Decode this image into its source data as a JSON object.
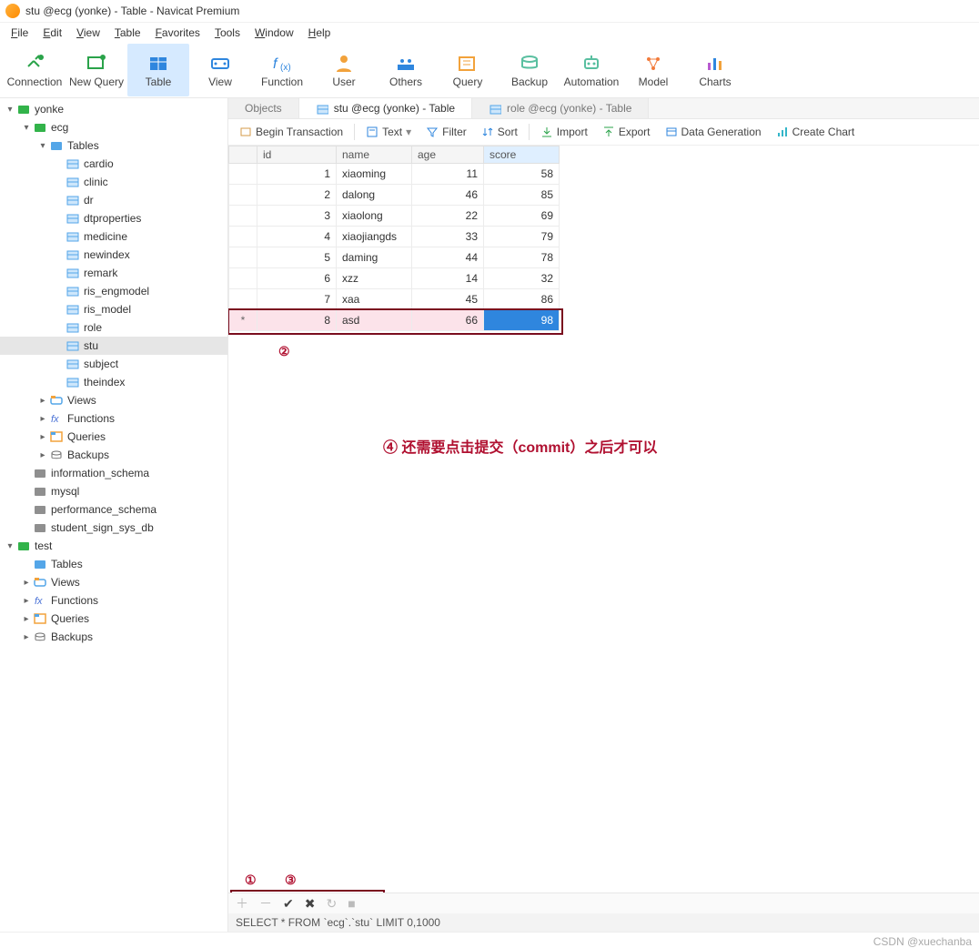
{
  "window": {
    "title": "stu @ecg (yonke) - Table - Navicat Premium"
  },
  "menu": [
    "File",
    "Edit",
    "View",
    "Table",
    "Favorites",
    "Tools",
    "Window",
    "Help"
  ],
  "toolbar": [
    {
      "label": "Connection",
      "icon": "plug",
      "color": "#2aa34a"
    },
    {
      "label": "New Query",
      "icon": "query",
      "color": "#2aa34a"
    },
    {
      "label": "Table",
      "icon": "table",
      "color": "#2f86de",
      "active": true
    },
    {
      "label": "View",
      "icon": "view",
      "color": "#2f86de"
    },
    {
      "label": "Function",
      "icon": "fx",
      "color": "#2f86de"
    },
    {
      "label": "User",
      "icon": "user",
      "color": "#f2a23b"
    },
    {
      "label": "Others",
      "icon": "others",
      "color": "#2f86de"
    },
    {
      "label": "Query",
      "icon": "query2",
      "color": "#f2a23b"
    },
    {
      "label": "Backup",
      "icon": "backup",
      "color": "#59bfa0"
    },
    {
      "label": "Automation",
      "icon": "robot",
      "color": "#59bfa0"
    },
    {
      "label": "Model",
      "icon": "model",
      "color": "#f27b3b"
    },
    {
      "label": "Charts",
      "icon": "charts",
      "color": "#7a5bd0"
    }
  ],
  "tree": [
    {
      "d": 0,
      "tw": "▾",
      "ico": "dbgreen",
      "label": "yonke"
    },
    {
      "d": 1,
      "tw": "▾",
      "ico": "dbgreen",
      "label": "ecg"
    },
    {
      "d": 2,
      "tw": "▾",
      "ico": "folder",
      "label": "Tables"
    },
    {
      "d": 3,
      "tw": "",
      "ico": "tbl",
      "label": "cardio"
    },
    {
      "d": 3,
      "tw": "",
      "ico": "tbl",
      "label": "clinic"
    },
    {
      "d": 3,
      "tw": "",
      "ico": "tbl",
      "label": "dr"
    },
    {
      "d": 3,
      "tw": "",
      "ico": "tbl",
      "label": "dtproperties"
    },
    {
      "d": 3,
      "tw": "",
      "ico": "tbl",
      "label": "medicine"
    },
    {
      "d": 3,
      "tw": "",
      "ico": "tbl",
      "label": "newindex"
    },
    {
      "d": 3,
      "tw": "",
      "ico": "tbl",
      "label": "remark"
    },
    {
      "d": 3,
      "tw": "",
      "ico": "tbl",
      "label": "ris_engmodel"
    },
    {
      "d": 3,
      "tw": "",
      "ico": "tbl",
      "label": "ris_model"
    },
    {
      "d": 3,
      "tw": "",
      "ico": "tbl",
      "label": "role"
    },
    {
      "d": 3,
      "tw": "",
      "ico": "tbl",
      "label": "stu",
      "selected": true
    },
    {
      "d": 3,
      "tw": "",
      "ico": "tbl",
      "label": "subject"
    },
    {
      "d": 3,
      "tw": "",
      "ico": "tbl",
      "label": "theindex"
    },
    {
      "d": 2,
      "tw": "▸",
      "ico": "views",
      "label": "Views"
    },
    {
      "d": 2,
      "tw": "▸",
      "ico": "fx",
      "label": "Functions"
    },
    {
      "d": 2,
      "tw": "▸",
      "ico": "query",
      "label": "Queries"
    },
    {
      "d": 2,
      "tw": "▸",
      "ico": "backup",
      "label": "Backups"
    },
    {
      "d": 1,
      "tw": "",
      "ico": "dbgrey",
      "label": "information_schema"
    },
    {
      "d": 1,
      "tw": "",
      "ico": "dbgrey",
      "label": "mysql"
    },
    {
      "d": 1,
      "tw": "",
      "ico": "dbgrey",
      "label": "performance_schema"
    },
    {
      "d": 1,
      "tw": "",
      "ico": "dbgrey",
      "label": "student_sign_sys_db"
    },
    {
      "d": 0,
      "tw": "▾",
      "ico": "dbgreen",
      "label": "test"
    },
    {
      "d": 1,
      "tw": "",
      "ico": "folder",
      "label": "Tables"
    },
    {
      "d": 1,
      "tw": "▸",
      "ico": "views",
      "label": "Views"
    },
    {
      "d": 1,
      "tw": "▸",
      "ico": "fx",
      "label": "Functions"
    },
    {
      "d": 1,
      "tw": "▸",
      "ico": "query",
      "label": "Queries"
    },
    {
      "d": 1,
      "tw": "▸",
      "ico": "backup",
      "label": "Backups"
    }
  ],
  "tabs": [
    {
      "label": "Objects",
      "active": false,
      "icon": ""
    },
    {
      "label": "stu @ecg (yonke) - Table",
      "active": true,
      "icon": "tbl"
    },
    {
      "label": "role @ecg (yonke) - Table",
      "active": false,
      "icon": "tbl"
    }
  ],
  "objToolbar": {
    "begin": "Begin Transaction",
    "text": "Text",
    "filter": "Filter",
    "sort": "Sort",
    "import": "Import",
    "export": "Export",
    "datagen": "Data Generation",
    "chart": "Create Chart"
  },
  "grid": {
    "cols": [
      "id",
      "name",
      "age",
      "score"
    ],
    "widths": [
      74,
      70,
      66,
      70
    ],
    "rows": [
      {
        "mark": "",
        "id": 1,
        "name": "xiaoming",
        "age": 11,
        "score": 58
      },
      {
        "mark": "",
        "id": 2,
        "name": "dalong",
        "age": 46,
        "score": 85
      },
      {
        "mark": "",
        "id": 3,
        "name": "xiaolong",
        "age": 22,
        "score": 69
      },
      {
        "mark": "",
        "id": 4,
        "name": "xiaojiangds",
        "age": 33,
        "score": 79
      },
      {
        "mark": "",
        "id": 5,
        "name": "daming",
        "age": 44,
        "score": 78
      },
      {
        "mark": "",
        "id": 6,
        "name": "xzz",
        "age": 14,
        "score": 32
      },
      {
        "mark": "",
        "id": 7,
        "name": "xaa",
        "age": 45,
        "score": 86
      },
      {
        "mark": "*",
        "id": 8,
        "name": "asd",
        "age": 66,
        "score": 98,
        "new": true,
        "sel": true
      }
    ]
  },
  "annotations": {
    "a1": "①",
    "a2": "②",
    "a3": "③",
    "a4": "④ 还需要点击提交（commit）之后才可以"
  },
  "sql": "SELECT * FROM `ecg`.`stu` LIMIT 0,1000",
  "watermark": "CSDN @xuechanba"
}
